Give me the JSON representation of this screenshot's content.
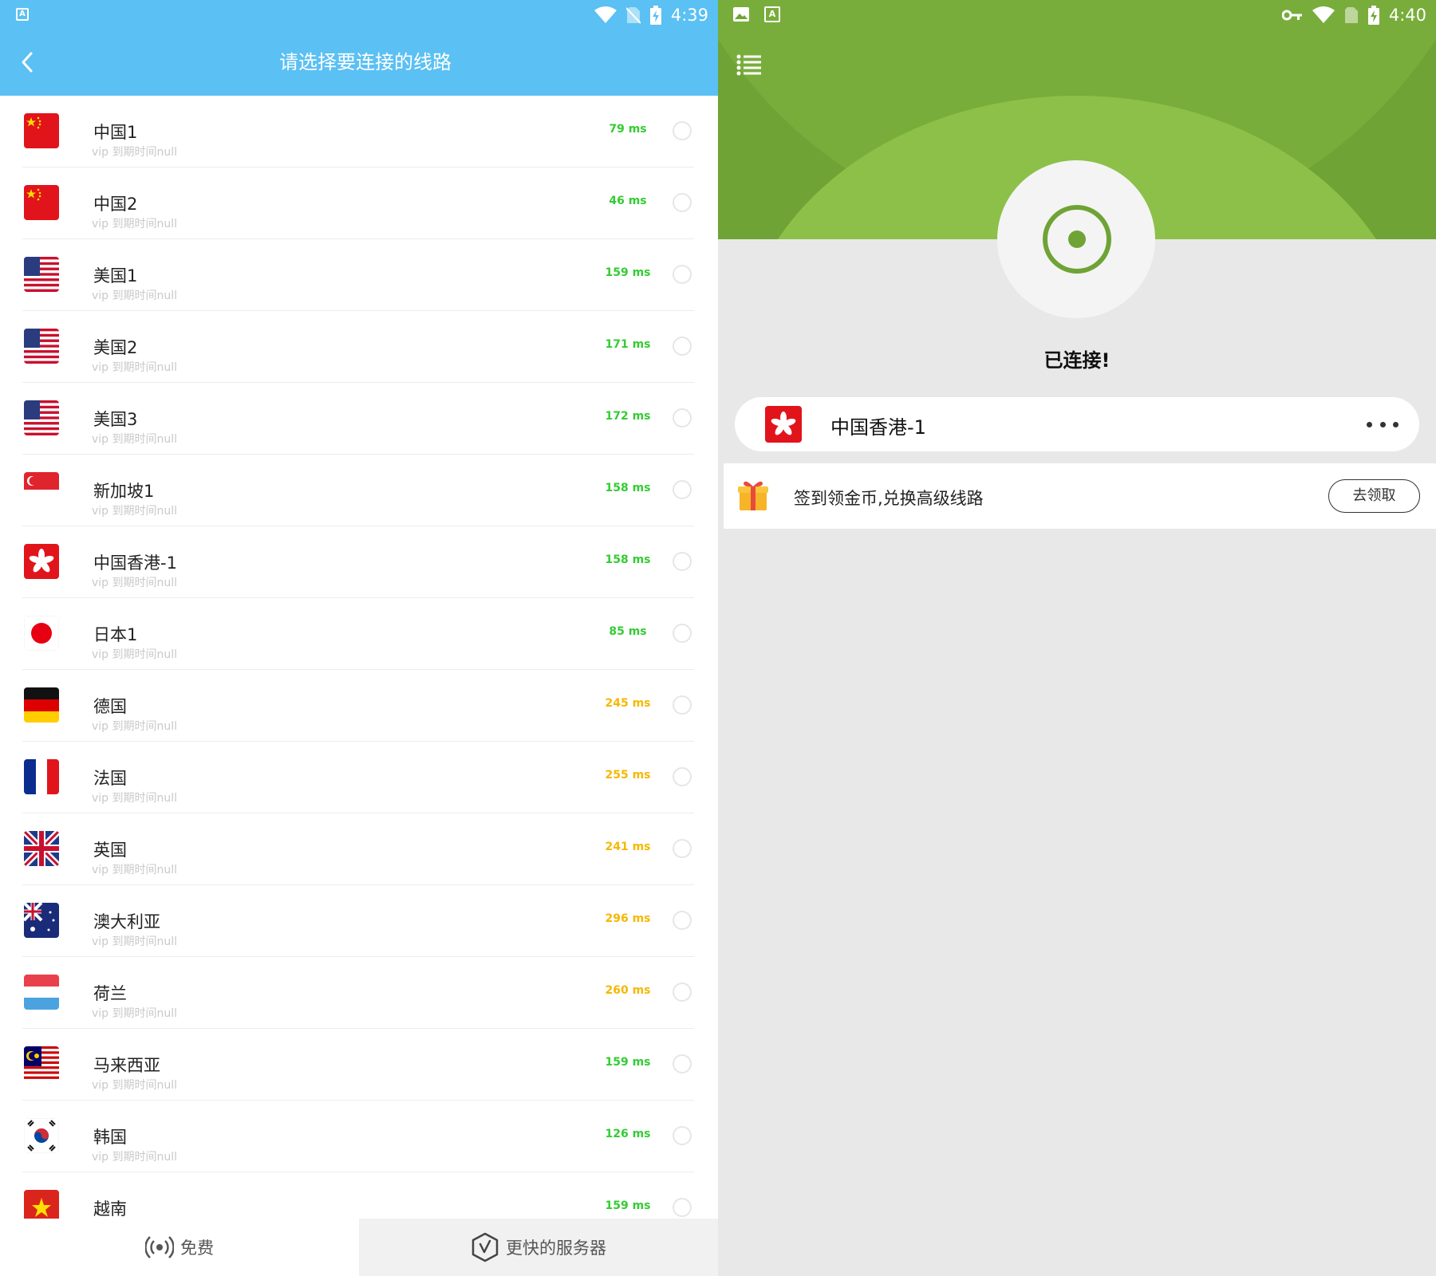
{
  "left": {
    "status_bar": {
      "time": "4:39",
      "notif_letter": "A"
    },
    "header": {
      "title": "请选择要连接的线路"
    },
    "servers": [
      {
        "name": "中国1",
        "sub": "vip 到期时间null",
        "latency": "79 ms",
        "latency_color": "#33cc33",
        "flag": "cn-flag"
      },
      {
        "name": "中国2",
        "sub": "vip 到期时间null",
        "latency": "46 ms",
        "latency_color": "#33cc33",
        "flag": "cn-flag"
      },
      {
        "name": "美国1",
        "sub": "vip 到期时间null",
        "latency": "159 ms",
        "latency_color": "#33cc33",
        "flag": "us-flag"
      },
      {
        "name": "美国2",
        "sub": "vip 到期时间null",
        "latency": "171 ms",
        "latency_color": "#33cc33",
        "flag": "us-flag"
      },
      {
        "name": "美国3",
        "sub": "vip 到期时间null",
        "latency": "172 ms",
        "latency_color": "#33cc33",
        "flag": "us-flag"
      },
      {
        "name": "新加坡1",
        "sub": "vip 到期时间null",
        "latency": "158 ms",
        "latency_color": "#33cc33",
        "flag": "sg-flag"
      },
      {
        "name": "中国香港-1",
        "sub": "vip 到期时间null",
        "latency": "158 ms",
        "latency_color": "#33cc33",
        "flag": "hk-flag"
      },
      {
        "name": "日本1",
        "sub": "vip 到期时间null",
        "latency": "85 ms",
        "latency_color": "#33cc33",
        "flag": "jp-flag"
      },
      {
        "name": "德国",
        "sub": "vip 到期时间null",
        "latency": "245 ms",
        "latency_color": "#f5b800",
        "flag": "de-flag"
      },
      {
        "name": "法国",
        "sub": "vip 到期时间null",
        "latency": "255 ms",
        "latency_color": "#f5b800",
        "flag": "fr-flag"
      },
      {
        "name": "英国",
        "sub": "vip 到期时间null",
        "latency": "241 ms",
        "latency_color": "#f5b800",
        "flag": "gb-flag"
      },
      {
        "name": "澳大利亚",
        "sub": "vip 到期时间null",
        "latency": "296 ms",
        "latency_color": "#f5b800",
        "flag": "au-flag"
      },
      {
        "name": "荷兰",
        "sub": "vip 到期时间null",
        "latency": "260 ms",
        "latency_color": "#f5b800",
        "flag": "nl-flag"
      },
      {
        "name": "马来西亚",
        "sub": "vip 到期时间null",
        "latency": "159 ms",
        "latency_color": "#33cc33",
        "flag": "my-flag"
      },
      {
        "name": "韩国",
        "sub": "vip 到期时间null",
        "latency": "126 ms",
        "latency_color": "#33cc33",
        "flag": "kr-flag"
      },
      {
        "name": "越南",
        "sub": "",
        "latency": "159 ms",
        "latency_color": "#33cc33",
        "flag": "vn-flag"
      }
    ],
    "bottom_tabs": {
      "free": "免费",
      "faster": "更快的服务器"
    }
  },
  "right": {
    "status_bar": {
      "time": "4:40",
      "notif_letter": "A"
    },
    "status_text": "已连接!",
    "current_server": {
      "name": "中国香港-1",
      "flag": "hk-flag"
    },
    "reward": {
      "text": "签到领金币,兑换高级线路",
      "button": "去领取"
    },
    "colors": {
      "hero_green": "#6fa336",
      "ring_green": "#6fa336"
    }
  },
  "colors": {
    "header_blue": "#5bc0f3",
    "good_latency": "#33cc33",
    "slow_latency": "#f5b800"
  }
}
